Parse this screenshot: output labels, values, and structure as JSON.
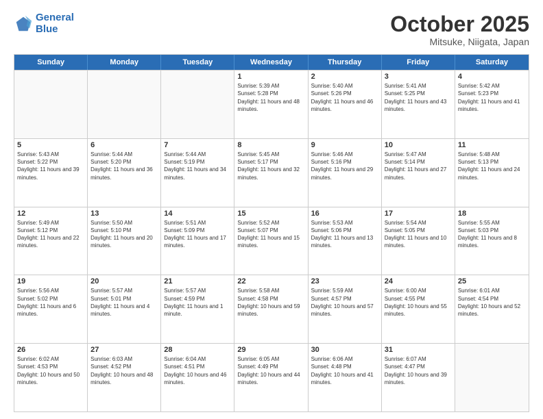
{
  "logo": {
    "line1": "General",
    "line2": "Blue"
  },
  "title": "October 2025",
  "location": "Mitsuke, Niigata, Japan",
  "days_of_week": [
    "Sunday",
    "Monday",
    "Tuesday",
    "Wednesday",
    "Thursday",
    "Friday",
    "Saturday"
  ],
  "weeks": [
    [
      {
        "day": "",
        "sunrise": "",
        "sunset": "",
        "daylight": ""
      },
      {
        "day": "",
        "sunrise": "",
        "sunset": "",
        "daylight": ""
      },
      {
        "day": "",
        "sunrise": "",
        "sunset": "",
        "daylight": ""
      },
      {
        "day": "1",
        "sunrise": "Sunrise: 5:39 AM",
        "sunset": "Sunset: 5:28 PM",
        "daylight": "Daylight: 11 hours and 48 minutes."
      },
      {
        "day": "2",
        "sunrise": "Sunrise: 5:40 AM",
        "sunset": "Sunset: 5:26 PM",
        "daylight": "Daylight: 11 hours and 46 minutes."
      },
      {
        "day": "3",
        "sunrise": "Sunrise: 5:41 AM",
        "sunset": "Sunset: 5:25 PM",
        "daylight": "Daylight: 11 hours and 43 minutes."
      },
      {
        "day": "4",
        "sunrise": "Sunrise: 5:42 AM",
        "sunset": "Sunset: 5:23 PM",
        "daylight": "Daylight: 11 hours and 41 minutes."
      }
    ],
    [
      {
        "day": "5",
        "sunrise": "Sunrise: 5:43 AM",
        "sunset": "Sunset: 5:22 PM",
        "daylight": "Daylight: 11 hours and 39 minutes."
      },
      {
        "day": "6",
        "sunrise": "Sunrise: 5:44 AM",
        "sunset": "Sunset: 5:20 PM",
        "daylight": "Daylight: 11 hours and 36 minutes."
      },
      {
        "day": "7",
        "sunrise": "Sunrise: 5:44 AM",
        "sunset": "Sunset: 5:19 PM",
        "daylight": "Daylight: 11 hours and 34 minutes."
      },
      {
        "day": "8",
        "sunrise": "Sunrise: 5:45 AM",
        "sunset": "Sunset: 5:17 PM",
        "daylight": "Daylight: 11 hours and 32 minutes."
      },
      {
        "day": "9",
        "sunrise": "Sunrise: 5:46 AM",
        "sunset": "Sunset: 5:16 PM",
        "daylight": "Daylight: 11 hours and 29 minutes."
      },
      {
        "day": "10",
        "sunrise": "Sunrise: 5:47 AM",
        "sunset": "Sunset: 5:14 PM",
        "daylight": "Daylight: 11 hours and 27 minutes."
      },
      {
        "day": "11",
        "sunrise": "Sunrise: 5:48 AM",
        "sunset": "Sunset: 5:13 PM",
        "daylight": "Daylight: 11 hours and 24 minutes."
      }
    ],
    [
      {
        "day": "12",
        "sunrise": "Sunrise: 5:49 AM",
        "sunset": "Sunset: 5:12 PM",
        "daylight": "Daylight: 11 hours and 22 minutes."
      },
      {
        "day": "13",
        "sunrise": "Sunrise: 5:50 AM",
        "sunset": "Sunset: 5:10 PM",
        "daylight": "Daylight: 11 hours and 20 minutes."
      },
      {
        "day": "14",
        "sunrise": "Sunrise: 5:51 AM",
        "sunset": "Sunset: 5:09 PM",
        "daylight": "Daylight: 11 hours and 17 minutes."
      },
      {
        "day": "15",
        "sunrise": "Sunrise: 5:52 AM",
        "sunset": "Sunset: 5:07 PM",
        "daylight": "Daylight: 11 hours and 15 minutes."
      },
      {
        "day": "16",
        "sunrise": "Sunrise: 5:53 AM",
        "sunset": "Sunset: 5:06 PM",
        "daylight": "Daylight: 11 hours and 13 minutes."
      },
      {
        "day": "17",
        "sunrise": "Sunrise: 5:54 AM",
        "sunset": "Sunset: 5:05 PM",
        "daylight": "Daylight: 11 hours and 10 minutes."
      },
      {
        "day": "18",
        "sunrise": "Sunrise: 5:55 AM",
        "sunset": "Sunset: 5:03 PM",
        "daylight": "Daylight: 11 hours and 8 minutes."
      }
    ],
    [
      {
        "day": "19",
        "sunrise": "Sunrise: 5:56 AM",
        "sunset": "Sunset: 5:02 PM",
        "daylight": "Daylight: 11 hours and 6 minutes."
      },
      {
        "day": "20",
        "sunrise": "Sunrise: 5:57 AM",
        "sunset": "Sunset: 5:01 PM",
        "daylight": "Daylight: 11 hours and 4 minutes."
      },
      {
        "day": "21",
        "sunrise": "Sunrise: 5:57 AM",
        "sunset": "Sunset: 4:59 PM",
        "daylight": "Daylight: 11 hours and 1 minute."
      },
      {
        "day": "22",
        "sunrise": "Sunrise: 5:58 AM",
        "sunset": "Sunset: 4:58 PM",
        "daylight": "Daylight: 10 hours and 59 minutes."
      },
      {
        "day": "23",
        "sunrise": "Sunrise: 5:59 AM",
        "sunset": "Sunset: 4:57 PM",
        "daylight": "Daylight: 10 hours and 57 minutes."
      },
      {
        "day": "24",
        "sunrise": "Sunrise: 6:00 AM",
        "sunset": "Sunset: 4:55 PM",
        "daylight": "Daylight: 10 hours and 55 minutes."
      },
      {
        "day": "25",
        "sunrise": "Sunrise: 6:01 AM",
        "sunset": "Sunset: 4:54 PM",
        "daylight": "Daylight: 10 hours and 52 minutes."
      }
    ],
    [
      {
        "day": "26",
        "sunrise": "Sunrise: 6:02 AM",
        "sunset": "Sunset: 4:53 PM",
        "daylight": "Daylight: 10 hours and 50 minutes."
      },
      {
        "day": "27",
        "sunrise": "Sunrise: 6:03 AM",
        "sunset": "Sunset: 4:52 PM",
        "daylight": "Daylight: 10 hours and 48 minutes."
      },
      {
        "day": "28",
        "sunrise": "Sunrise: 6:04 AM",
        "sunset": "Sunset: 4:51 PM",
        "daylight": "Daylight: 10 hours and 46 minutes."
      },
      {
        "day": "29",
        "sunrise": "Sunrise: 6:05 AM",
        "sunset": "Sunset: 4:49 PM",
        "daylight": "Daylight: 10 hours and 44 minutes."
      },
      {
        "day": "30",
        "sunrise": "Sunrise: 6:06 AM",
        "sunset": "Sunset: 4:48 PM",
        "daylight": "Daylight: 10 hours and 41 minutes."
      },
      {
        "day": "31",
        "sunrise": "Sunrise: 6:07 AM",
        "sunset": "Sunset: 4:47 PM",
        "daylight": "Daylight: 10 hours and 39 minutes."
      },
      {
        "day": "",
        "sunrise": "",
        "sunset": "",
        "daylight": ""
      }
    ]
  ]
}
